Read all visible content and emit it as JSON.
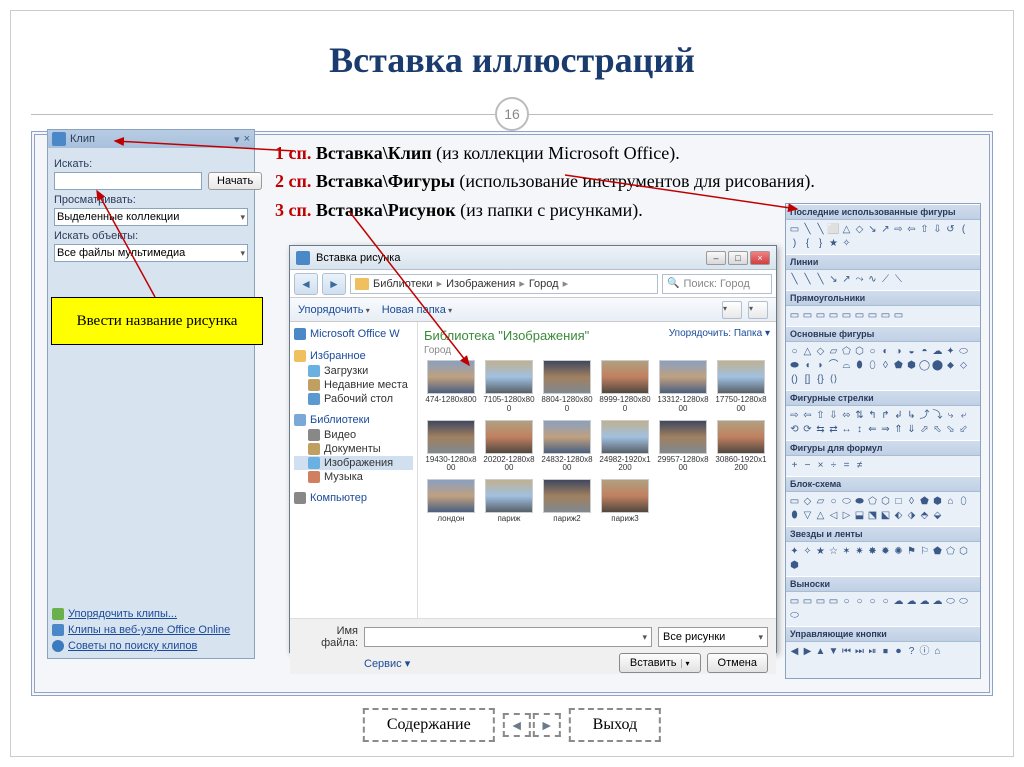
{
  "slide": {
    "title": "Вставка иллюстраций",
    "page_number": "16"
  },
  "body": {
    "line1_num": "1 сп.",
    "line1_bold": "Вставка\\Клип",
    "line1_rest": " (из коллекции Microsoft Office).",
    "line2_num": "2 сп.",
    "line2_bold": "Вставка\\Фигуры",
    "line2_rest": " (использование инструментов для рисования).",
    "line3_num": "3 сп.",
    "line3_bold": "Вставка\\Рисунок",
    "line3_rest": " (из папки с рисунками)."
  },
  "callout": "Ввести название рисунка",
  "clip": {
    "title": "Клип",
    "search_label": "Искать:",
    "search_btn": "Начать",
    "browse_label": "Просматривать:",
    "browse_value": "Выделенные коллекции",
    "objects_label": "Искать объекты:",
    "objects_value": "Все файлы мультимедиа",
    "link1": "Упорядочить клипы...",
    "link2": "Клипы на веб-узле Office Online",
    "link3": "Советы по поиску клипов"
  },
  "dialog": {
    "title": "Вставка рисунка",
    "crumbs": [
      "Библиотеки",
      "Изображения",
      "Город"
    ],
    "search_placeholder": "Поиск: Город",
    "organize": "Упорядочить",
    "new_folder": "Новая папка",
    "side_header": "Microsoft Office W",
    "side_groups": {
      "fav": "Избранное",
      "fav_items": [
        "Загрузки",
        "Недавние места",
        "Рабочий стол"
      ],
      "lib": "Библиотеки",
      "lib_items": [
        "Видео",
        "Документы",
        "Изображения",
        "Музыка"
      ],
      "comp": "Компьютер"
    },
    "files_header": "Библиотека \"Изображения\"",
    "files_sub": "Город",
    "arrange": "Упорядочить:",
    "arrange_val": "Папка",
    "thumbs": [
      "474-1280x800",
      "7105-1280x800",
      "8804-1280x800",
      "8999-1280x800",
      "13312-1280x800",
      "17750-1280x800",
      "19430-1280x800",
      "20202-1280x800",
      "24832-1280x800",
      "24982-1920x1200",
      "29957-1280x800",
      "30860-1920x1200",
      "лондон",
      "париж",
      "париж2",
      "париж3"
    ],
    "filename_label": "Имя файла:",
    "filetype": "Все рисунки",
    "service": "Сервис",
    "insert": "Вставить",
    "cancel": "Отмена"
  },
  "shapes": {
    "cats": [
      "Последние использованные фигуры",
      "Линии",
      "Прямоугольники",
      "Основные фигуры",
      "Фигурные стрелки",
      "Фигуры для формул",
      "Блок-схема",
      "Звезды и ленты",
      "Выноски",
      "Управляющие кнопки"
    ]
  },
  "nav": {
    "toc": "Содержание",
    "exit": "Выход"
  }
}
